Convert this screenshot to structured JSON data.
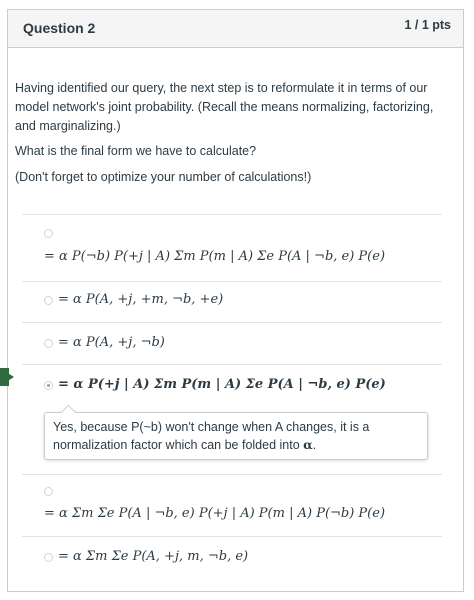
{
  "question": {
    "title": "Question 2",
    "points": "1 / 1 pts",
    "prompt": "Having identified our query, the next step is to reformulate it in terms of our model network's joint probability. (Recall the means normalizing, factorizing, and marginalizing.)",
    "ask": "What is the final form we have to calculate?",
    "hint": "(Don't forget to optimize your number of calculations!)"
  },
  "answers": [
    {
      "text": "= α P(¬b) P(+j | A) Σm P(m | A) Σe P(A | ¬b, e) P(e)",
      "selected": false
    },
    {
      "text": "= α P(A, +j, +m, ¬b, +e)",
      "selected": false
    },
    {
      "text": "= α P(A, +j, ¬b)",
      "selected": false
    },
    {
      "text": "= α P(+j | A) Σm P(m | A) Σe P(A | ¬b, e) P(e)",
      "selected": true
    },
    {
      "text": "= α Σm Σe P(A | ¬b, e) P(+j | A) P(m | A) P(¬b) P(e)",
      "selected": false
    },
    {
      "text": "= α Σm Σe P(A, +j, m, ¬b, e)",
      "selected": false
    }
  ],
  "feedback": {
    "text": "Yes, because P(~b) won't change when A changes, it is a normalization factor which can be folded into",
    "symbol": "α",
    "end": "."
  },
  "colors": {
    "correct_marker": "#2e6b3f",
    "border": "#c7cdd1",
    "header_bg": "#f5f5f5"
  }
}
